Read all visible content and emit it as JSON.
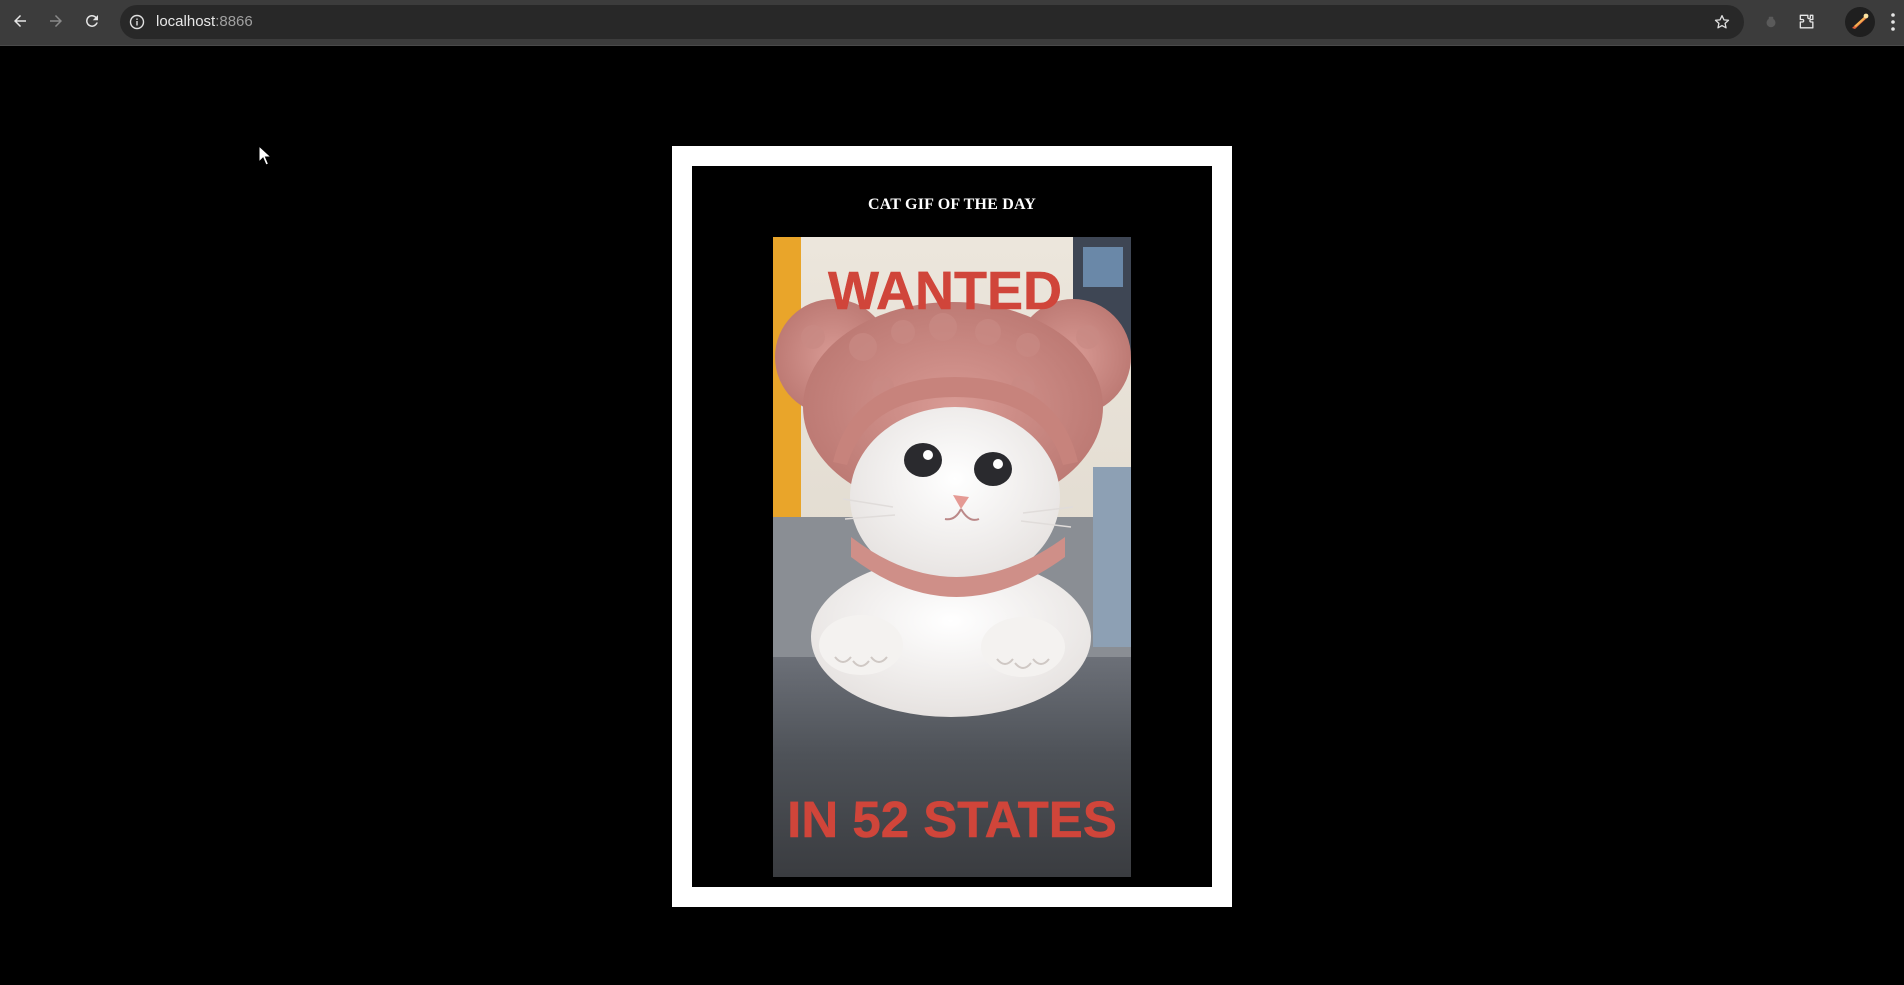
{
  "browser": {
    "url_host": "localhost",
    "url_port": ":8866",
    "icons": {
      "back": "arrow-left-icon",
      "forward": "arrow-right-icon",
      "reload": "reload-icon",
      "site_info": "info-icon",
      "bookmark": "star-icon",
      "extension_puzzle": "puzzle-icon",
      "menu": "kebab-menu-icon"
    }
  },
  "card": {
    "title": "CAT GIF OF THE DAY",
    "gif": {
      "top_text": "WANTED",
      "bottom_text": "IN 52 STATES",
      "text_color": "#d0453a"
    }
  },
  "colors": {
    "page_background": "#000000",
    "frame": "#ffffff",
    "chrome_bar": "#3c3c3c",
    "omnibox": "#282828"
  }
}
